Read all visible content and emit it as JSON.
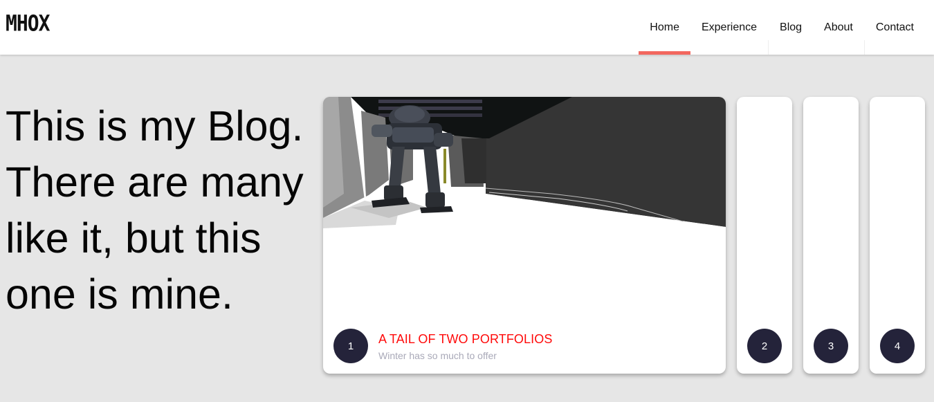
{
  "header": {
    "logo": "MHOX",
    "nav": [
      {
        "label": "Home",
        "active": true
      },
      {
        "label": "Experience",
        "active": false
      },
      {
        "label": "Blog",
        "active": false
      },
      {
        "label": "About",
        "active": false
      },
      {
        "label": "Contact",
        "active": false
      }
    ],
    "active_indicator_color": "#f2675f"
  },
  "hero": {
    "text": "This is my Blog. There are many like it, but this one is mine."
  },
  "cards": [
    {
      "number": "1",
      "title": "A TAIL OF TWO PORTFOLIOS",
      "subtitle": "Winter has so much to offer",
      "image": "robot-3d-scene",
      "expanded": true
    },
    {
      "number": "2",
      "expanded": false
    },
    {
      "number": "3",
      "expanded": false
    },
    {
      "number": "4",
      "expanded": false
    }
  ],
  "colors": {
    "background": "#e6e6e6",
    "badge": "#24233a",
    "title": "#ff0a0a",
    "subtitle": "#a9a9b8"
  }
}
